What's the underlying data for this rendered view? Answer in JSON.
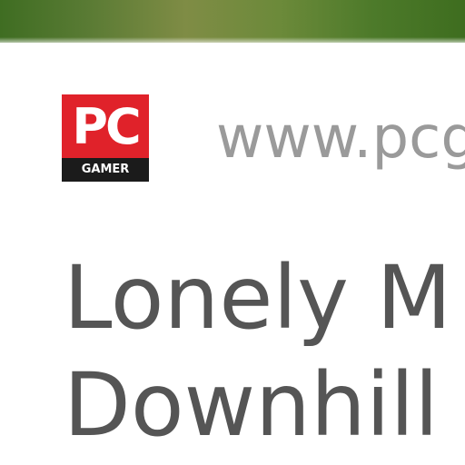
{
  "source": {
    "logo_main": "PC",
    "logo_sub": "GAMER",
    "url": "www.pcg"
  },
  "headline": {
    "line1": "Lonely M",
    "line2": "Downhill"
  },
  "colors": {
    "logo_red": "#e0222a",
    "logo_bar": "#1b1b1b",
    "url_text": "#9a9a9a",
    "headline_text": "#555555"
  }
}
